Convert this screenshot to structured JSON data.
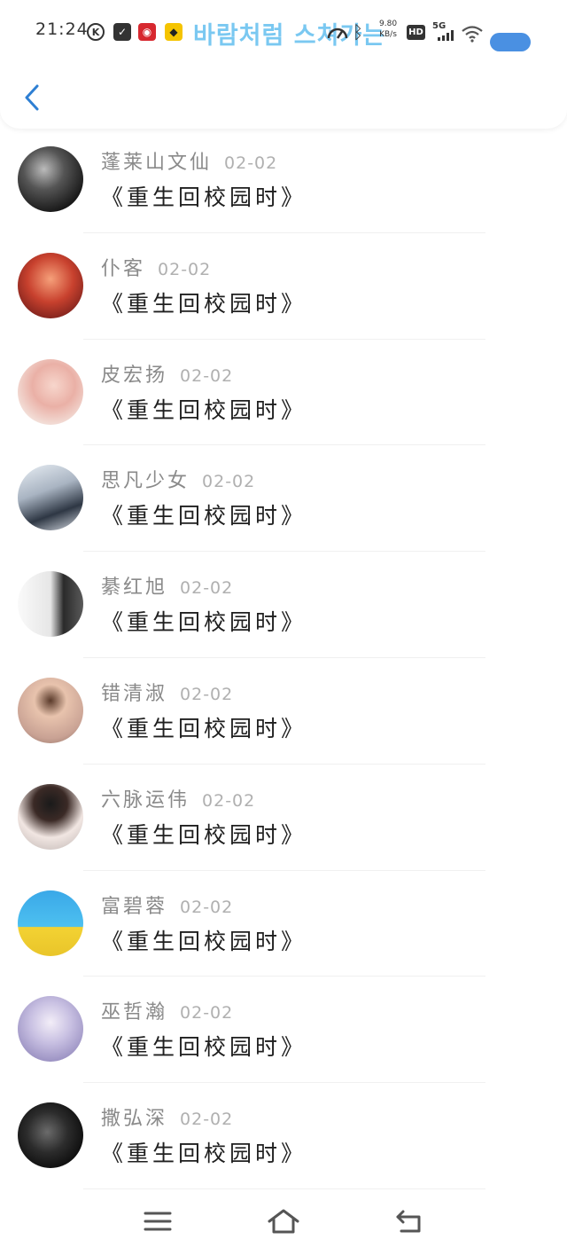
{
  "status_bar": {
    "time": "21:24",
    "k_icon": "K",
    "overlay_text": "바람처럼 스쳐가는",
    "speed_value": "9.80",
    "speed_unit": "KB/s",
    "hd_label": "HD",
    "network_label": "5G",
    "battery_color": "#4a90e2"
  },
  "header": {
    "back_icon": "chevron-left-icon",
    "accent_color": "#2e7fd3"
  },
  "list": {
    "items": [
      {
        "name": "蓬莱山文仙",
        "date": "02-02",
        "message": "《重生回校园时》",
        "avatar": "avatar-bw-portrait"
      },
      {
        "name": "仆客",
        "date": "02-02",
        "message": "《重生回校园时》",
        "avatar": "avatar-umbrella-red"
      },
      {
        "name": "皮宏扬",
        "date": "02-02",
        "message": "《重生回校园时》",
        "avatar": "avatar-flowers"
      },
      {
        "name": "思凡少女",
        "date": "02-02",
        "message": "《重生回校园时》",
        "avatar": "avatar-couple"
      },
      {
        "name": "綦红旭",
        "date": "02-02",
        "message": "《重生回校园时》",
        "avatar": "avatar-bw-couple"
      },
      {
        "name": "错清淑",
        "date": "02-02",
        "message": "《重生回校园时》",
        "avatar": "avatar-girl"
      },
      {
        "name": "六脉运伟",
        "date": "02-02",
        "message": "《重生回校园时》",
        "avatar": "avatar-girl-white"
      },
      {
        "name": "富碧蓉",
        "date": "02-02",
        "message": "《重生回校园时》",
        "avatar": "avatar-spongebob"
      },
      {
        "name": "巫哲瀚",
        "date": "02-02",
        "message": "《重生回校园时》",
        "avatar": "avatar-anime-purple"
      },
      {
        "name": "撒弘深",
        "date": "02-02",
        "message": "《重生回校园时》",
        "avatar": "avatar-dark-figure"
      }
    ]
  },
  "nav_bar": {
    "menu_icon": "menu-icon",
    "home_icon": "home-icon",
    "back_icon": "back-icon"
  }
}
